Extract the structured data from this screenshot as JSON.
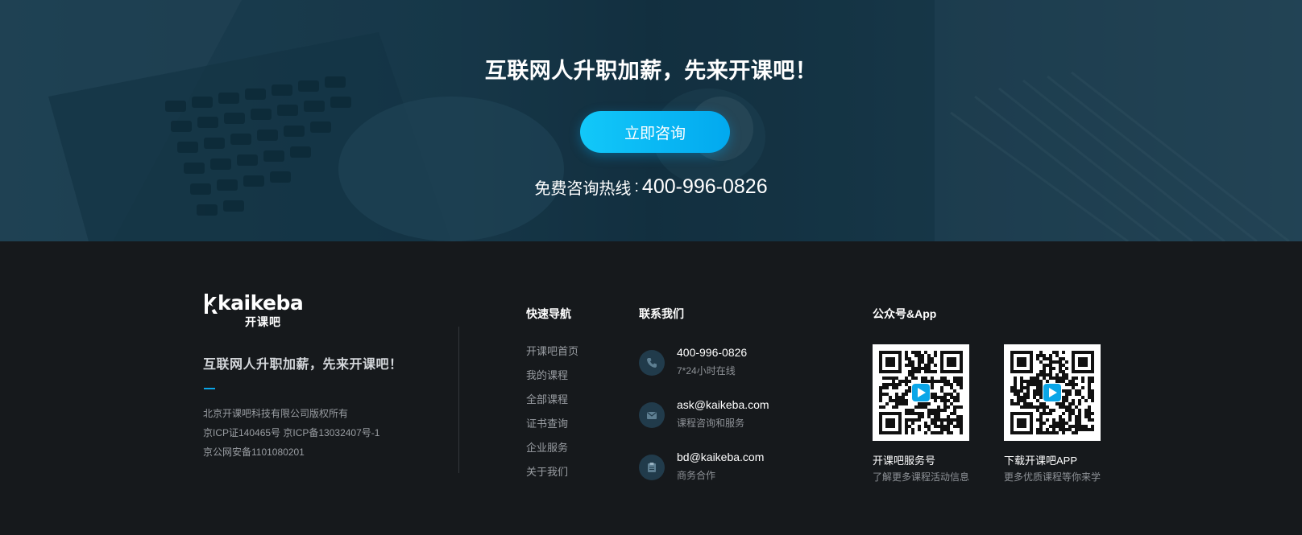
{
  "hero": {
    "title": "互联网人升职加薪，先来开课吧！",
    "cta_label": "立即咨询",
    "hotline_label": "免费咨询热线",
    "hotline_separator": ":",
    "hotline_number": "400-996-0826"
  },
  "brand": {
    "logo_word": "kaikeba",
    "logo_sub": "开课吧",
    "slogan": "互联网人升职加薪，先来开课吧！",
    "company_lines": [
      "北京开课吧科技有限公司版权所有",
      "京ICP证140465号 京ICP备13032407号-1",
      "京公网安备1101080201"
    ]
  },
  "nav": {
    "title": "快速导航",
    "items": [
      "开课吧首页",
      "我的课程",
      "全部课程",
      "证书查询",
      "企业服务",
      "关于我们"
    ]
  },
  "contact": {
    "title": "联系我们",
    "items": [
      {
        "icon": "phone-icon",
        "main": "400-996-0826",
        "sub": "7*24小时在线"
      },
      {
        "icon": "mail-icon",
        "main": "ask@kaikeba.com",
        "sub": "课程咨询和服务"
      },
      {
        "icon": "clipboard-icon",
        "main": "bd@kaikeba.com",
        "sub": "商务合作"
      }
    ]
  },
  "qr": {
    "title": "公众号&App",
    "items": [
      {
        "label": "开课吧服务号",
        "sub": "了解更多课程活动信息"
      },
      {
        "label": "下载开课吧APP",
        "sub": "更多优质课程等你来学"
      }
    ]
  },
  "colors": {
    "accent": "#02a9ef",
    "footer_bg": "#16191c",
    "icon_circle": "#213b4b"
  }
}
